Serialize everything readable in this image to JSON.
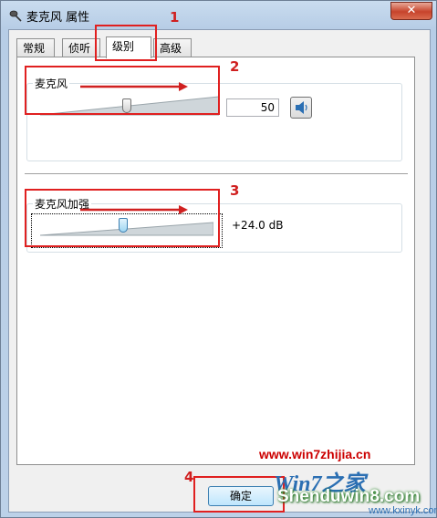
{
  "window": {
    "title": "麦克风 属性",
    "close_glyph": "✕"
  },
  "tabs": [
    {
      "label": "常规",
      "active": false
    },
    {
      "label": "侦听",
      "active": false
    },
    {
      "label": "级别",
      "active": true
    },
    {
      "label": "高级",
      "active": false
    }
  ],
  "microphone": {
    "label": "麦克风",
    "value": "50",
    "level": 0.5
  },
  "boost": {
    "label": "麦克风加强",
    "value": "+24.0 dB"
  },
  "buttons": {
    "ok": "确定"
  },
  "annotations": {
    "n1": "1",
    "n2": "2",
    "n3": "3",
    "n4": "4",
    "color": "#e02020"
  },
  "watermark": {
    "url": "www.win7zhijia.cn",
    "logo": "Win7之家",
    "brand": "Shenduwin8.com",
    "sub": "www.kxinyk.com"
  }
}
